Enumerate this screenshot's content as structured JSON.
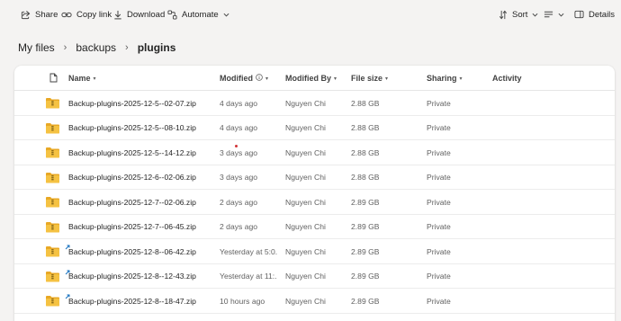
{
  "toolbar": {
    "share": "Share",
    "copy_link": "Copy link",
    "download": "Download",
    "automate": "Automate",
    "sort": "Sort",
    "details": "Details"
  },
  "breadcrumb": {
    "root": "My files",
    "parent": "backups",
    "current": "plugins"
  },
  "columns": {
    "name": "Name",
    "modified": "Modified",
    "modified_by": "Modified By",
    "file_size": "File size",
    "sharing": "Sharing",
    "activity": "Activity"
  },
  "files": [
    {
      "name": "Backup-plugins-2025-12-5--02-07.zip",
      "modified": "4 days ago",
      "modified_by": "Nguyen Chi",
      "size": "2.88 GB",
      "sharing": "Private",
      "new": false
    },
    {
      "name": "Backup-plugins-2025-12-5--08-10.zip",
      "modified": "4 days ago",
      "modified_by": "Nguyen Chi",
      "size": "2.88 GB",
      "sharing": "Private",
      "new": false
    },
    {
      "name": "Backup-plugins-2025-12-5--14-12.zip",
      "modified": "3 days ago",
      "modified_by": "Nguyen Chi",
      "size": "2.88 GB",
      "sharing": "Private",
      "new": false
    },
    {
      "name": "Backup-plugins-2025-12-6--02-06.zip",
      "modified": "3 days ago",
      "modified_by": "Nguyen Chi",
      "size": "2.88 GB",
      "sharing": "Private",
      "new": false
    },
    {
      "name": "Backup-plugins-2025-12-7--02-06.zip",
      "modified": "2 days ago",
      "modified_by": "Nguyen Chi",
      "size": "2.89 GB",
      "sharing": "Private",
      "new": false
    },
    {
      "name": "Backup-plugins-2025-12-7--06-45.zip",
      "modified": "2 days ago",
      "modified_by": "Nguyen Chi",
      "size": "2.89 GB",
      "sharing": "Private",
      "new": false
    },
    {
      "name": "Backup-plugins-2025-12-8--06-42.zip",
      "modified": "Yesterday at 5:0...",
      "modified_by": "Nguyen Chi",
      "size": "2.89 GB",
      "sharing": "Private",
      "new": true
    },
    {
      "name": "Backup-plugins-2025-12-8--12-43.zip",
      "modified": "Yesterday at 11:...",
      "modified_by": "Nguyen Chi",
      "size": "2.89 GB",
      "sharing": "Private",
      "new": true
    },
    {
      "name": "Backup-plugins-2025-12-8--18-47.zip",
      "modified": "10 hours ago",
      "modified_by": "Nguyen Chi",
      "size": "2.89 GB",
      "sharing": "Private",
      "new": true
    }
  ],
  "colors": {
    "folder_zip_body": "#f5c242",
    "folder_zip_tab": "#e8a825",
    "new_mark": "#0f6cbd",
    "background": "#f4f3f2"
  }
}
